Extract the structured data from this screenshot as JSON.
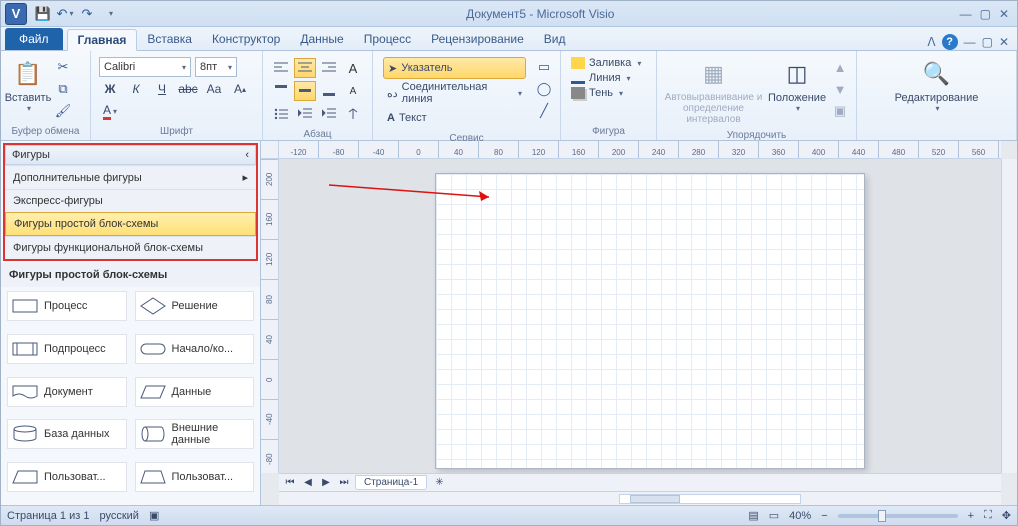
{
  "title": "Документ5 - Microsoft Visio",
  "app_initial": "V",
  "tabs": {
    "file": "Файл",
    "items": [
      "Главная",
      "Вставка",
      "Конструктор",
      "Данные",
      "Процесс",
      "Рецензирование",
      "Вид"
    ],
    "active_index": 0
  },
  "ribbon": {
    "clipboard": {
      "label": "Буфер обмена",
      "paste": "Вставить"
    },
    "font": {
      "label": "Шрифт",
      "name": "Calibri",
      "size": "8пт",
      "abbr_bold": "Ж",
      "abbr_italic": "К",
      "abbr_underline": "Ч",
      "abbr_strike": "abc",
      "abbr_case": "Aa",
      "abbr_super": "A"
    },
    "paragraph": {
      "label": "Абзац",
      "fontsize_big": "A"
    },
    "tools": {
      "label": "Сервис",
      "pointer": "Указатель",
      "connector": "Соединительная линия",
      "text": "Текст",
      "letter": "A"
    },
    "shape": {
      "label": "Фигура",
      "fill": "Заливка",
      "line": "Линия",
      "shadow": "Тень"
    },
    "arrange": {
      "label": "Упорядочить",
      "autoalign": "Автовыравнивание и определение интервалов",
      "position": "Положение"
    },
    "editing": {
      "label": "Редактирование"
    }
  },
  "shapes_pane": {
    "header": "Фигуры",
    "items": [
      {
        "label": "Дополнительные фигуры",
        "arrow": true
      },
      {
        "label": "Экспресс-фигуры"
      },
      {
        "label": "Фигуры простой блок-схемы",
        "selected": true
      },
      {
        "label": "Фигуры функциональной блок-схемы"
      }
    ],
    "stencil_title": "Фигуры простой блок-схемы",
    "stencil": [
      {
        "label": "Процесс",
        "shape": "rect"
      },
      {
        "label": "Решение",
        "shape": "diamond"
      },
      {
        "label": "Подпроцесс",
        "shape": "subproc"
      },
      {
        "label": "Начало/ко...",
        "shape": "rounded"
      },
      {
        "label": "Документ",
        "shape": "doc"
      },
      {
        "label": "Данные",
        "shape": "para"
      },
      {
        "label": "База данных",
        "shape": "cyl"
      },
      {
        "label": "Внешние данные",
        "shape": "cyl2"
      },
      {
        "label": "Пользоват...",
        "shape": "trap"
      },
      {
        "label": "Пользоват...",
        "shape": "trap2"
      }
    ]
  },
  "ruler_h": [
    "-120",
    "-80",
    "-40",
    "0",
    "40",
    "80",
    "120",
    "160",
    "200",
    "240",
    "280",
    "320",
    "360",
    "400",
    "440",
    "480",
    "520",
    "560"
  ],
  "ruler_v": [
    "200",
    "160",
    "120",
    "80",
    "40",
    "0",
    "-40",
    "-80"
  ],
  "page_tabs": {
    "name": "Страница-1"
  },
  "status": {
    "page": "Страница 1 из 1",
    "lang": "русский",
    "zoom": "40%"
  }
}
